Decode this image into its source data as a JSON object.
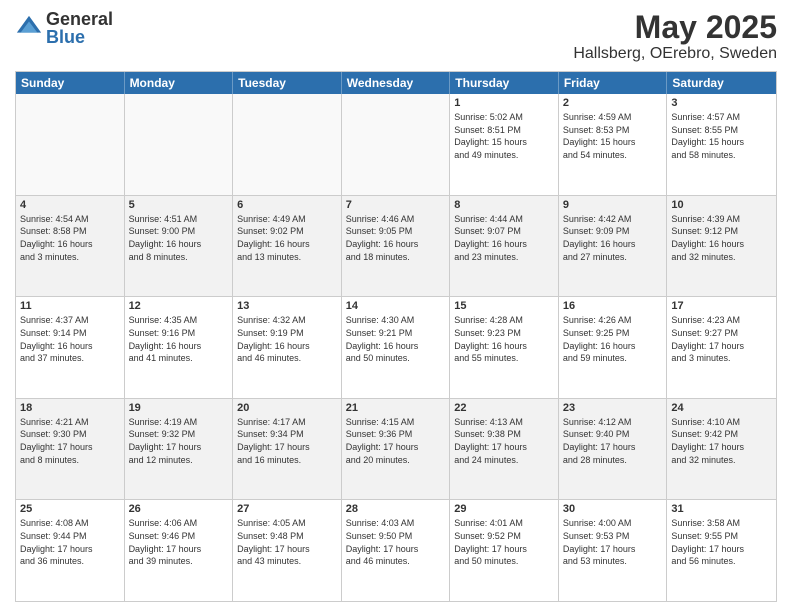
{
  "logo": {
    "general": "General",
    "blue": "Blue"
  },
  "title": "May 2025",
  "subtitle": "Hallsberg, OErebro, Sweden",
  "days": [
    "Sunday",
    "Monday",
    "Tuesday",
    "Wednesday",
    "Thursday",
    "Friday",
    "Saturday"
  ],
  "rows": [
    [
      {
        "num": "",
        "text": "",
        "empty": true
      },
      {
        "num": "",
        "text": "",
        "empty": true
      },
      {
        "num": "",
        "text": "",
        "empty": true
      },
      {
        "num": "",
        "text": "",
        "empty": true
      },
      {
        "num": "1",
        "text": "Sunrise: 5:02 AM\nSunset: 8:51 PM\nDaylight: 15 hours\nand 49 minutes."
      },
      {
        "num": "2",
        "text": "Sunrise: 4:59 AM\nSunset: 8:53 PM\nDaylight: 15 hours\nand 54 minutes."
      },
      {
        "num": "3",
        "text": "Sunrise: 4:57 AM\nSunset: 8:55 PM\nDaylight: 15 hours\nand 58 minutes."
      }
    ],
    [
      {
        "num": "4",
        "text": "Sunrise: 4:54 AM\nSunset: 8:58 PM\nDaylight: 16 hours\nand 3 minutes."
      },
      {
        "num": "5",
        "text": "Sunrise: 4:51 AM\nSunset: 9:00 PM\nDaylight: 16 hours\nand 8 minutes."
      },
      {
        "num": "6",
        "text": "Sunrise: 4:49 AM\nSunset: 9:02 PM\nDaylight: 16 hours\nand 13 minutes."
      },
      {
        "num": "7",
        "text": "Sunrise: 4:46 AM\nSunset: 9:05 PM\nDaylight: 16 hours\nand 18 minutes."
      },
      {
        "num": "8",
        "text": "Sunrise: 4:44 AM\nSunset: 9:07 PM\nDaylight: 16 hours\nand 23 minutes."
      },
      {
        "num": "9",
        "text": "Sunrise: 4:42 AM\nSunset: 9:09 PM\nDaylight: 16 hours\nand 27 minutes."
      },
      {
        "num": "10",
        "text": "Sunrise: 4:39 AM\nSunset: 9:12 PM\nDaylight: 16 hours\nand 32 minutes."
      }
    ],
    [
      {
        "num": "11",
        "text": "Sunrise: 4:37 AM\nSunset: 9:14 PM\nDaylight: 16 hours\nand 37 minutes."
      },
      {
        "num": "12",
        "text": "Sunrise: 4:35 AM\nSunset: 9:16 PM\nDaylight: 16 hours\nand 41 minutes."
      },
      {
        "num": "13",
        "text": "Sunrise: 4:32 AM\nSunset: 9:19 PM\nDaylight: 16 hours\nand 46 minutes."
      },
      {
        "num": "14",
        "text": "Sunrise: 4:30 AM\nSunset: 9:21 PM\nDaylight: 16 hours\nand 50 minutes."
      },
      {
        "num": "15",
        "text": "Sunrise: 4:28 AM\nSunset: 9:23 PM\nDaylight: 16 hours\nand 55 minutes."
      },
      {
        "num": "16",
        "text": "Sunrise: 4:26 AM\nSunset: 9:25 PM\nDaylight: 16 hours\nand 59 minutes."
      },
      {
        "num": "17",
        "text": "Sunrise: 4:23 AM\nSunset: 9:27 PM\nDaylight: 17 hours\nand 3 minutes."
      }
    ],
    [
      {
        "num": "18",
        "text": "Sunrise: 4:21 AM\nSunset: 9:30 PM\nDaylight: 17 hours\nand 8 minutes."
      },
      {
        "num": "19",
        "text": "Sunrise: 4:19 AM\nSunset: 9:32 PM\nDaylight: 17 hours\nand 12 minutes."
      },
      {
        "num": "20",
        "text": "Sunrise: 4:17 AM\nSunset: 9:34 PM\nDaylight: 17 hours\nand 16 minutes."
      },
      {
        "num": "21",
        "text": "Sunrise: 4:15 AM\nSunset: 9:36 PM\nDaylight: 17 hours\nand 20 minutes."
      },
      {
        "num": "22",
        "text": "Sunrise: 4:13 AM\nSunset: 9:38 PM\nDaylight: 17 hours\nand 24 minutes."
      },
      {
        "num": "23",
        "text": "Sunrise: 4:12 AM\nSunset: 9:40 PM\nDaylight: 17 hours\nand 28 minutes."
      },
      {
        "num": "24",
        "text": "Sunrise: 4:10 AM\nSunset: 9:42 PM\nDaylight: 17 hours\nand 32 minutes."
      }
    ],
    [
      {
        "num": "25",
        "text": "Sunrise: 4:08 AM\nSunset: 9:44 PM\nDaylight: 17 hours\nand 36 minutes."
      },
      {
        "num": "26",
        "text": "Sunrise: 4:06 AM\nSunset: 9:46 PM\nDaylight: 17 hours\nand 39 minutes."
      },
      {
        "num": "27",
        "text": "Sunrise: 4:05 AM\nSunset: 9:48 PM\nDaylight: 17 hours\nand 43 minutes."
      },
      {
        "num": "28",
        "text": "Sunrise: 4:03 AM\nSunset: 9:50 PM\nDaylight: 17 hours\nand 46 minutes."
      },
      {
        "num": "29",
        "text": "Sunrise: 4:01 AM\nSunset: 9:52 PM\nDaylight: 17 hours\nand 50 minutes."
      },
      {
        "num": "30",
        "text": "Sunrise: 4:00 AM\nSunset: 9:53 PM\nDaylight: 17 hours\nand 53 minutes."
      },
      {
        "num": "31",
        "text": "Sunrise: 3:58 AM\nSunset: 9:55 PM\nDaylight: 17 hours\nand 56 minutes."
      }
    ]
  ]
}
